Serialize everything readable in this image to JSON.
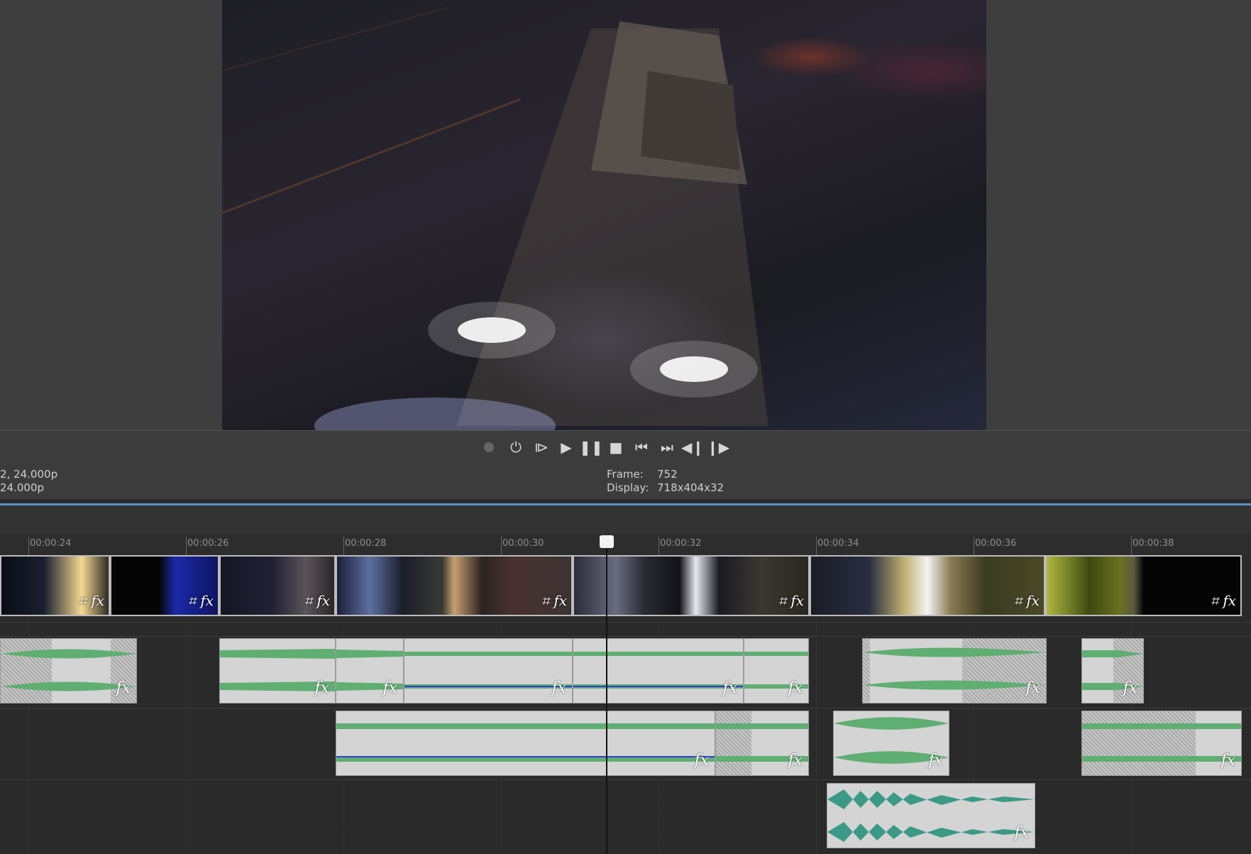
{
  "transport": {
    "buttons": [
      "record",
      "loop",
      "play-from-start",
      "play",
      "pause",
      "stop",
      "prev-frame",
      "next-frame",
      "prev-marker",
      "next-marker"
    ]
  },
  "status": {
    "left_line1": "2, 24.000p",
    "left_line2": "24.000p",
    "frame_label": "Frame:",
    "frame_value": "752",
    "display_label": "Display:",
    "display_value": "718x404x32"
  },
  "ruler": {
    "ticks": [
      "00:00:24",
      "00:00:26",
      "00:00:28",
      "00:00:30",
      "00:00:32",
      "00:00:34",
      "00:00:36",
      "00:00:38"
    ]
  },
  "clip_icons": {
    "crop": "⌗",
    "fx": "fx"
  },
  "colors": {
    "waveform": "#5fae72",
    "waveform_alt": "#3a9a86",
    "envelope": "#2f3fd6",
    "playhead": "#111111"
  }
}
